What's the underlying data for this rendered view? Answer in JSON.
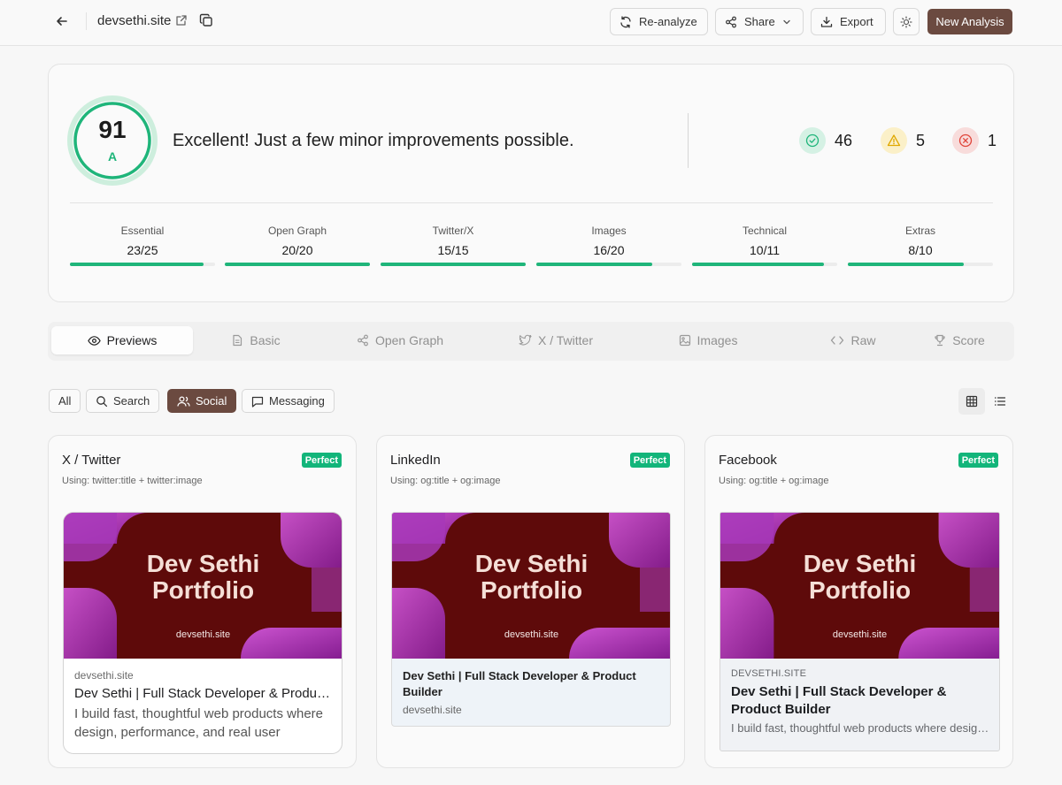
{
  "header": {
    "site": "devsethi.site",
    "buttons": {
      "reanalyze": "Re-analyze",
      "share": "Share",
      "export": "Export",
      "new_analysis": "New Analysis"
    }
  },
  "score": {
    "value": "91",
    "grade": "A",
    "message": "Excellent! Just a few minor improvements possible.",
    "passed": "46",
    "warnings": "5",
    "errors": "1",
    "colors": {
      "good": "#1fb57a",
      "warn": "#f0b400",
      "error": "#e0453a"
    }
  },
  "categories": [
    {
      "name": "Essential",
      "score": "23/25",
      "fraction": 0.92
    },
    {
      "name": "Open Graph",
      "score": "20/20",
      "fraction": 1.0
    },
    {
      "name": "Twitter/X",
      "score": "15/15",
      "fraction": 1.0
    },
    {
      "name": "Images",
      "score": "16/20",
      "fraction": 0.8
    },
    {
      "name": "Technical",
      "score": "10/11",
      "fraction": 0.91
    },
    {
      "name": "Extras",
      "score": "8/10",
      "fraction": 0.8
    }
  ],
  "tabs": [
    {
      "label": "Previews",
      "icon": "eye-icon"
    },
    {
      "label": "Basic",
      "icon": "file-icon"
    },
    {
      "label": "Open Graph",
      "icon": "share-nodes-icon"
    },
    {
      "label": "X / Twitter",
      "icon": "twitter-bird-icon"
    },
    {
      "label": "Images",
      "icon": "image-icon"
    },
    {
      "label": "Raw",
      "icon": "code-icon"
    },
    {
      "label": "Score",
      "icon": "trophy-icon"
    }
  ],
  "filters": [
    {
      "label": "All"
    },
    {
      "label": "Search",
      "icon": "search-icon"
    },
    {
      "label": "Social",
      "icon": "users-icon"
    },
    {
      "label": "Messaging",
      "icon": "message-icon"
    }
  ],
  "og_image": {
    "title_line1": "Dev Sethi",
    "title_line2": "Portfolio",
    "domain": "devsethi.site",
    "bg_color": "#5e0a0a",
    "accent_color": "#c94ad8"
  },
  "previews": [
    {
      "platform": "X / Twitter",
      "badge": "Perfect",
      "using": "Using: twitter:title + twitter:image",
      "domain": "devsethi.site",
      "title": "Dev Sethi | Full Stack Developer & Product Builder",
      "description": "I build fast, thoughtful web products where design, performance, and real user experience come together."
    },
    {
      "platform": "LinkedIn",
      "badge": "Perfect",
      "using": "Using: og:title + og:image",
      "title": "Dev Sethi | Full Stack Developer & Product Builder",
      "domain": "devsethi.site"
    },
    {
      "platform": "Facebook",
      "badge": "Perfect",
      "using": "Using: og:title + og:image",
      "domain": "DEVSETHI.SITE",
      "title": "Dev Sethi | Full Stack Developer & Product Builder",
      "description": "I build fast, thoughtful web products where design, performance, and real user experience come together."
    }
  ]
}
